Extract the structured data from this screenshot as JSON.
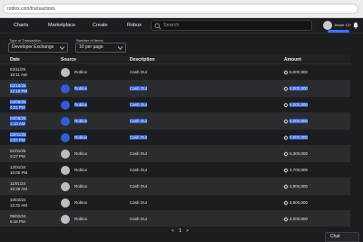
{
  "browser": {
    "url": "roblox.com/transactions"
  },
  "nav": {
    "items": [
      {
        "label": "Charts",
        "name": "nav-charts"
      },
      {
        "label": "Marketplace",
        "name": "nav-marketplace"
      },
      {
        "label": "Create",
        "name": "nav-create"
      },
      {
        "label": "Robux",
        "name": "nav-robux"
      }
    ],
    "search_placeholder": "Search",
    "username": "Jessie 13+"
  },
  "filters": {
    "type_label": "Type of Transaction",
    "type_value": "Developer Exchange",
    "items_label": "Number of Items",
    "items_value": "10 per page"
  },
  "table": {
    "headers": {
      "date": "Date",
      "source": "Source",
      "description": "Description",
      "amount": "Amount"
    },
    "rows": [
      {
        "date1": "02/11/25",
        "date2": "10:11 AM",
        "source": "Roblox",
        "description": "Cash Out",
        "amount": "5,000,000",
        "highlight": false,
        "avatar": "gray"
      },
      {
        "date1": "02/10/25",
        "date2": "12:18 PM",
        "source": "Roblox",
        "description": "Cash Out",
        "amount": "5,000,000",
        "highlight": true,
        "avatar": "blue"
      },
      {
        "date1": "02/09/25",
        "date2": "4:21 PM",
        "source": "Roblox",
        "description": "Cash Out",
        "amount": "5,000,000",
        "highlight": true,
        "avatar": "blue"
      },
      {
        "date1": "02/05/25",
        "date2": "1:10 AM",
        "source": "Roblox",
        "description": "Cash Out",
        "amount": "5,000,000",
        "highlight": true,
        "avatar": "blue"
      },
      {
        "date1": "02/01/25",
        "date2": "2:07 PM",
        "source": "Roblox",
        "description": "Cash Out",
        "amount": "5,000,000",
        "highlight": true,
        "avatar": "blue"
      },
      {
        "date1": "01/01/25",
        "date2": "3:27 PM",
        "source": "Roblox",
        "description": "Cash Out",
        "amount": "5,300,000",
        "highlight": false,
        "avatar": "gray"
      },
      {
        "date1": "12/01/24",
        "date2": "10:05 PM",
        "source": "Roblox",
        "description": "Cash Out",
        "amount": "3,700,000",
        "highlight": false,
        "avatar": "gray"
      },
      {
        "date1": "11/01/24",
        "date2": "10:38 AM",
        "source": "Roblox",
        "description": "Cash Out",
        "amount": "3,900,000",
        "highlight": false,
        "avatar": "gray"
      },
      {
        "date1": "10/02/24",
        "date2": "12:31 AM",
        "source": "Roblox",
        "description": "Cash Out",
        "amount": "3,900,000",
        "highlight": false,
        "avatar": "gray"
      },
      {
        "date1": "09/02/24",
        "date2": "6:16 PM",
        "source": "Roblox",
        "description": "Cash Out",
        "amount": "3,000,000",
        "highlight": false,
        "avatar": "gray"
      }
    ]
  },
  "pager": {
    "prev": "<",
    "page": "1",
    "next": ">"
  },
  "chat": {
    "label": "Chat"
  },
  "colors": {
    "background": "#1b1d20",
    "highlight": "#2f5fd0",
    "accent": "#3b73f5"
  }
}
